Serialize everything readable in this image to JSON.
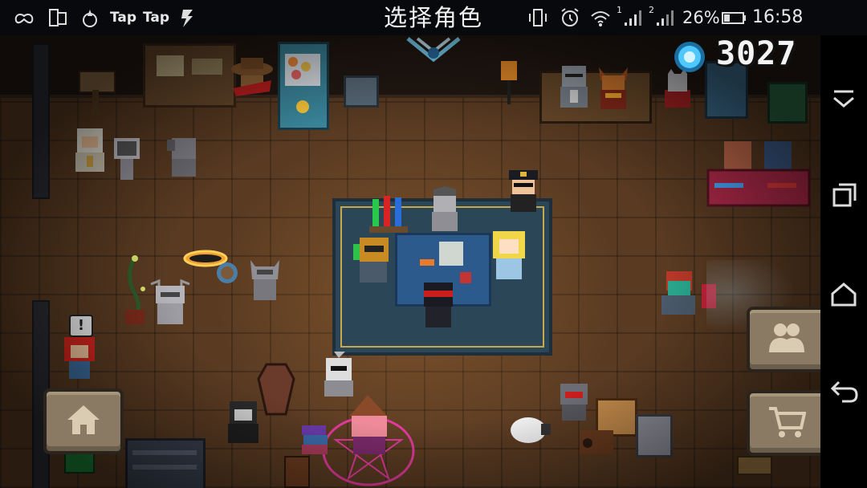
{
  "status_bar": {
    "title": "选择角色",
    "left_icons": [
      "game-controller-icon",
      "dual-screen-icon",
      "flame-drop-icon"
    ],
    "tap_labels": [
      "Tap",
      "Tap"
    ],
    "bolt_icon": "lightning-icon",
    "battery": "26%",
    "time": "16:58",
    "sim1": "1",
    "sim2": "2"
  },
  "hud": {
    "gem_count": "3027",
    "gem_icon": "gem-icon",
    "home_icon": "home-icon",
    "friends_icon": "friends-icon",
    "shop_icon": "shopping-cart-icon",
    "notice_mark": "!"
  },
  "nav": {
    "items": [
      "collapse-icon",
      "recent-apps-icon",
      "home-nav-icon",
      "back-icon"
    ]
  },
  "colors": {
    "floor": "#5a3b22",
    "rug": "#2b4657",
    "rug_border": "#c9a84c",
    "gem": "#4ec8ff",
    "button": "#8a7a63"
  }
}
